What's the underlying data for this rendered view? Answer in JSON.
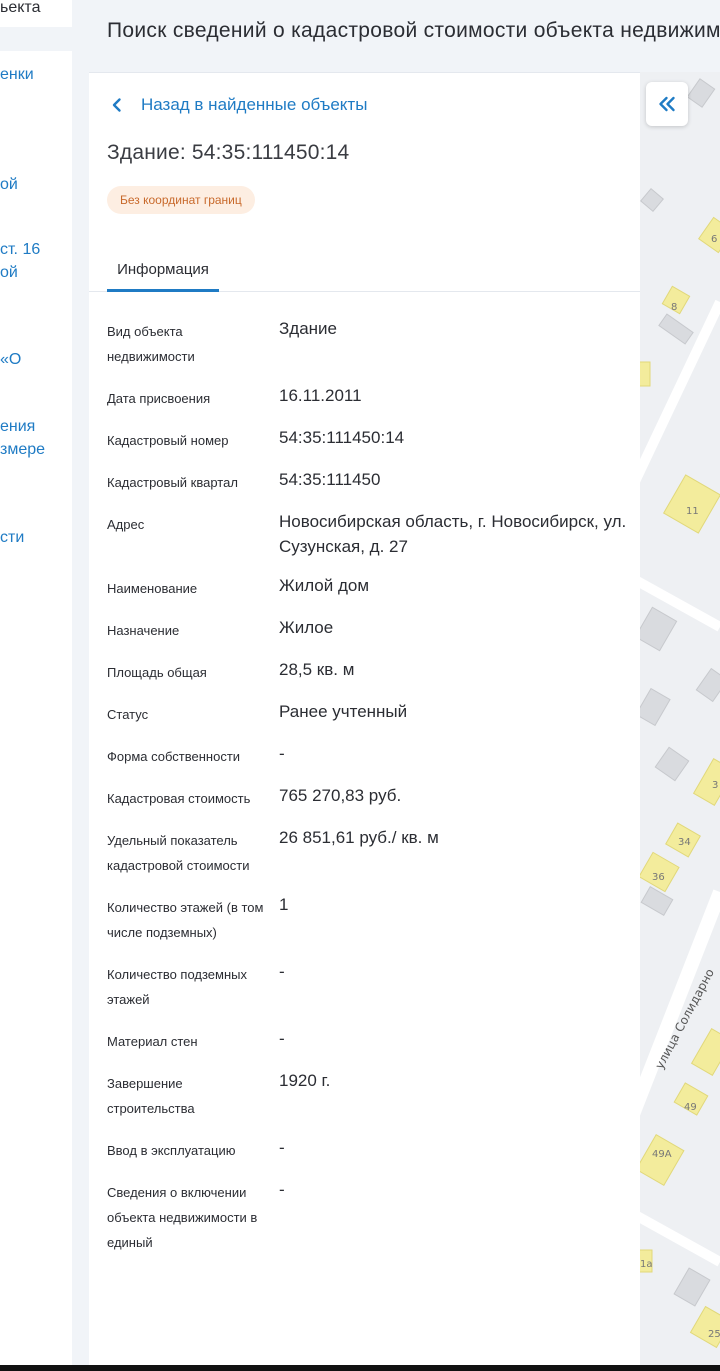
{
  "sidebar": {
    "fragments": [
      {
        "text": "ьекта",
        "style": "dark"
      },
      {
        "text": "енки",
        "style": "link"
      },
      {
        "text": "ой",
        "style": "link"
      },
      {
        "text": "ст. 16",
        "style": "link"
      },
      {
        "text": "ой",
        "style": "link"
      },
      {
        "text": "«О",
        "style": "link"
      },
      {
        "text": "ения",
        "style": "link"
      },
      {
        "text": "змере",
        "style": "link"
      },
      {
        "text": "сти",
        "style": "link"
      }
    ]
  },
  "header": {
    "title": "Поиск сведений о кадастровой стоимости объекта недвижимости"
  },
  "panel": {
    "back_label": "Назад в найденные объекты",
    "object_title": "Здание: 54:35:111450:14",
    "badge": "Без координат границ",
    "tab_info": "Информация"
  },
  "info_rows": [
    {
      "label": "Вид объекта недвижимости",
      "value": "Здание"
    },
    {
      "label": "Дата присвоения",
      "value": "16.11.2011"
    },
    {
      "label": "Кадастровый номер",
      "value": "54:35:111450:14"
    },
    {
      "label": "Кадастровый квартал",
      "value": "54:35:111450"
    },
    {
      "label": "Адрес",
      "value": "Новосибирская область, г. Новосибирск, ул. Сузунская, д. 27"
    },
    {
      "label": "Наименование",
      "value": "Жилой дом"
    },
    {
      "label": "Назначение",
      "value": "Жилое"
    },
    {
      "label": "Площадь общая",
      "value": "28,5 кв. м"
    },
    {
      "label": "Статус",
      "value": "Ранее учтенный"
    },
    {
      "label": "Форма собственности",
      "value": "-"
    },
    {
      "label": "Кадастровая стоимость",
      "value": "765 270,83 руб."
    },
    {
      "label": "Удельный показатель кадастровой стоимости",
      "value": "26 851,61 руб./ кв. м"
    },
    {
      "label": "Количество этажей (в том числе подземных)",
      "value": "1"
    },
    {
      "label": "Количество подземных этажей",
      "value": "-"
    },
    {
      "label": "Материал стен",
      "value": "-"
    },
    {
      "label": "Завершение строительства",
      "value": "1920 г."
    },
    {
      "label": "Ввод в эксплуатацию",
      "value": "-"
    },
    {
      "label": "Сведения о включении объекта недвижимости в единый",
      "value": "-"
    }
  ],
  "map": {
    "labels": [
      "6",
      "8",
      "11",
      "3",
      "34",
      "36",
      "улица Солидарно",
      "49",
      "49А",
      "1а",
      "25"
    ]
  },
  "colors": {
    "accent": "#1f7bc4",
    "badge_bg": "#fdeee2",
    "badge_text": "#c8692b",
    "building_yellow": "#f3ec9c"
  },
  "icons": {
    "back": "chevron-left-icon",
    "collapse": "double-chevron-left-icon"
  }
}
